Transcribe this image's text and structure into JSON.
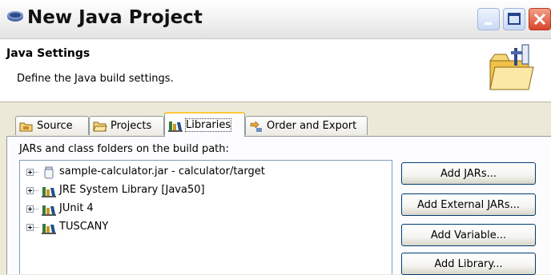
{
  "window": {
    "title": "New Java Project"
  },
  "header": {
    "title": "Java Settings",
    "description": "Define the Java build settings."
  },
  "tabs": [
    {
      "label": "Source",
      "icon": "source-folder-icon"
    },
    {
      "label": "Projects",
      "icon": "projects-folder-icon"
    },
    {
      "label": "Libraries",
      "icon": "library-icon",
      "selected": true
    },
    {
      "label": "Order and Export",
      "icon": "order-export-icon"
    }
  ],
  "libraries": {
    "label": "JARs and class folders on the build path:",
    "items": [
      {
        "label": "sample-calculator.jar - calculator/target",
        "icon": "jar-file-icon"
      },
      {
        "label": "JRE System Library [Java50]",
        "icon": "library-icon"
      },
      {
        "label": "JUnit 4",
        "icon": "library-icon"
      },
      {
        "label": "TUSCANY",
        "icon": "library-icon"
      }
    ],
    "buttons": {
      "add_jars": "Add JARs...",
      "add_external_jars": "Add External JARs...",
      "add_variable": "Add Variable...",
      "add_library": "Add Library..."
    }
  },
  "colors": {
    "dialog_background": "#ece9d8",
    "selected_tab_accent": "#ffc83c",
    "close_button": "#d8452a",
    "button_border": "#003c74"
  }
}
